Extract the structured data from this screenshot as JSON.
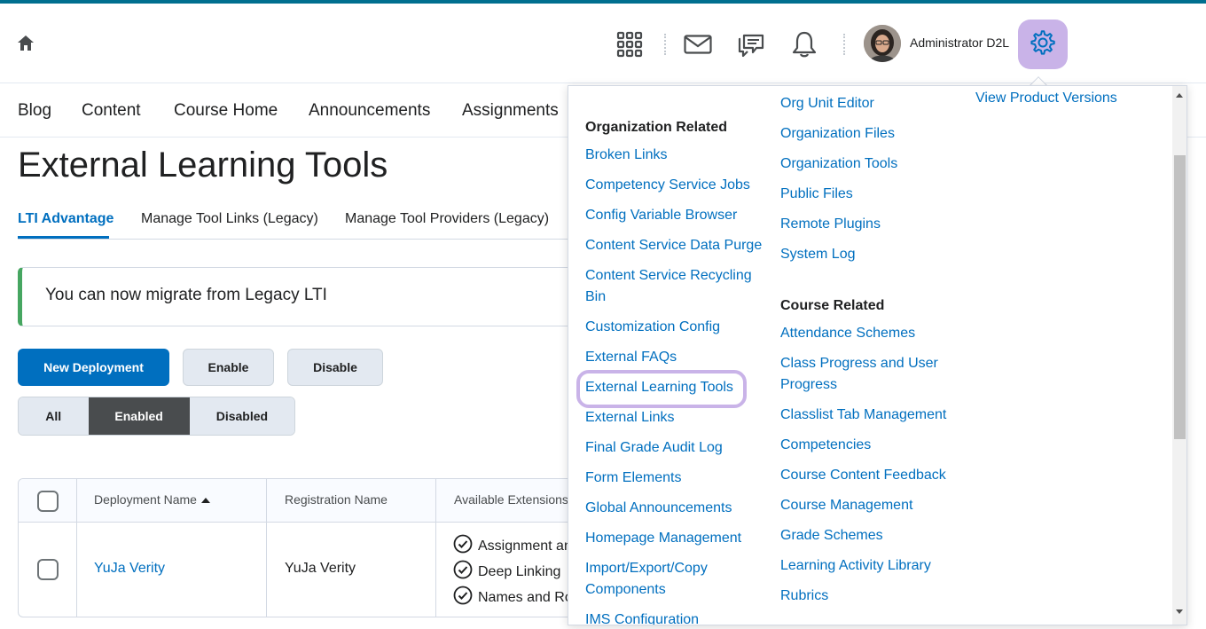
{
  "colors": {
    "primary": "#006fbf",
    "highlight": "#c9b3e8",
    "alert_accent": "#46a661",
    "brand_bar": "#006f8f"
  },
  "header": {
    "icons": [
      "home-icon",
      "waffle-grid-icon",
      "mail-icon",
      "chat-icon",
      "bell-icon",
      "gear-icon"
    ],
    "user_name": "Administrator D2L"
  },
  "nav": {
    "items": [
      "Blog",
      "Content",
      "Course Home",
      "Announcements",
      "Assignments"
    ]
  },
  "page": {
    "title": "External Learning Tools",
    "tabs": [
      "LTI Advantage",
      "Manage Tool Links (Legacy)",
      "Manage Tool Providers (Legacy)"
    ],
    "alert": "You can now migrate from Legacy LTI",
    "buttons": {
      "new": "New Deployment",
      "enable": "Enable",
      "disable": "Disable"
    },
    "filter": [
      "All",
      "Enabled",
      "Disabled"
    ],
    "table": {
      "headers": [
        "Deployment Name",
        "Registration Name",
        "Available Extensions"
      ],
      "rows": [
        {
          "deployment": "YuJa Verity",
          "registration": "YuJa Verity",
          "extensions": [
            "Assignment and Grade Services",
            "Deep Linking",
            "Names and Role Provisioning Services"
          ]
        }
      ]
    }
  },
  "admin_menu": {
    "top_link": "View Product Versions",
    "org_heading": "Organization Related",
    "org_col1": [
      "Broken Links",
      "Competency Service Jobs",
      "Config Variable Browser",
      "Content Service Data Purge",
      "Content Service Recycling Bin",
      "Customization Config",
      "External FAQs",
      "External Learning Tools",
      "External Links",
      "Final Grade Audit Log",
      "Form Elements",
      "Global Announcements",
      "Homepage Management",
      "Import/Export/Copy Components",
      "IMS Configuration"
    ],
    "org_col2": [
      "Org Unit Editor",
      "Organization Files",
      "Organization Tools",
      "Public Files",
      "Remote Plugins",
      "System Log"
    ],
    "course_heading": "Course Related",
    "course_items": [
      "Attendance Schemes",
      "Class Progress and User Progress",
      "Classlist Tab Management",
      "Competencies",
      "Course Content Feedback",
      "Course Management",
      "Grade Schemes",
      "Learning Activity Library",
      "Rubrics"
    ]
  }
}
